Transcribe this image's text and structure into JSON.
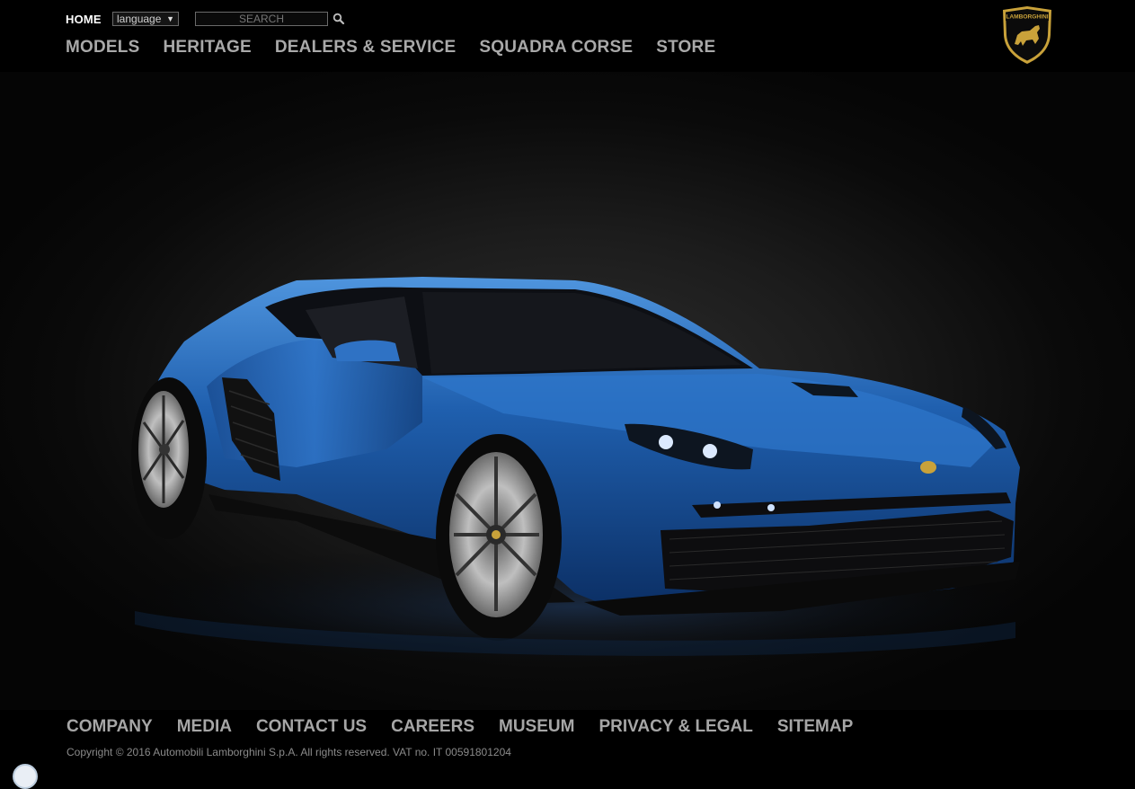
{
  "header": {
    "home_label": "HOME",
    "language_select": {
      "value": "language"
    },
    "search": {
      "placeholder": "SEARCH"
    },
    "nav": [
      "MODELS",
      "HERITAGE",
      "DEALERS & SERVICE",
      "SQUADRA CORSE",
      "STORE"
    ],
    "logo_text": "LAMBORGHINI"
  },
  "hero": {
    "car_color": "#1f5fae"
  },
  "footer": {
    "nav": [
      "COMPANY",
      "MEDIA",
      "CONTACT US",
      "CAREERS",
      "MUSEUM",
      "PRIVACY & LEGAL",
      "SITEMAP"
    ],
    "copyright": "Copyright © 2016 Automobili Lamborghini S.p.A. All rights reserved. VAT no. IT 00591801204"
  },
  "colors": {
    "nav_text": "#a9a9a9",
    "logo_gold": "#c9a23a",
    "background": "#000000"
  }
}
